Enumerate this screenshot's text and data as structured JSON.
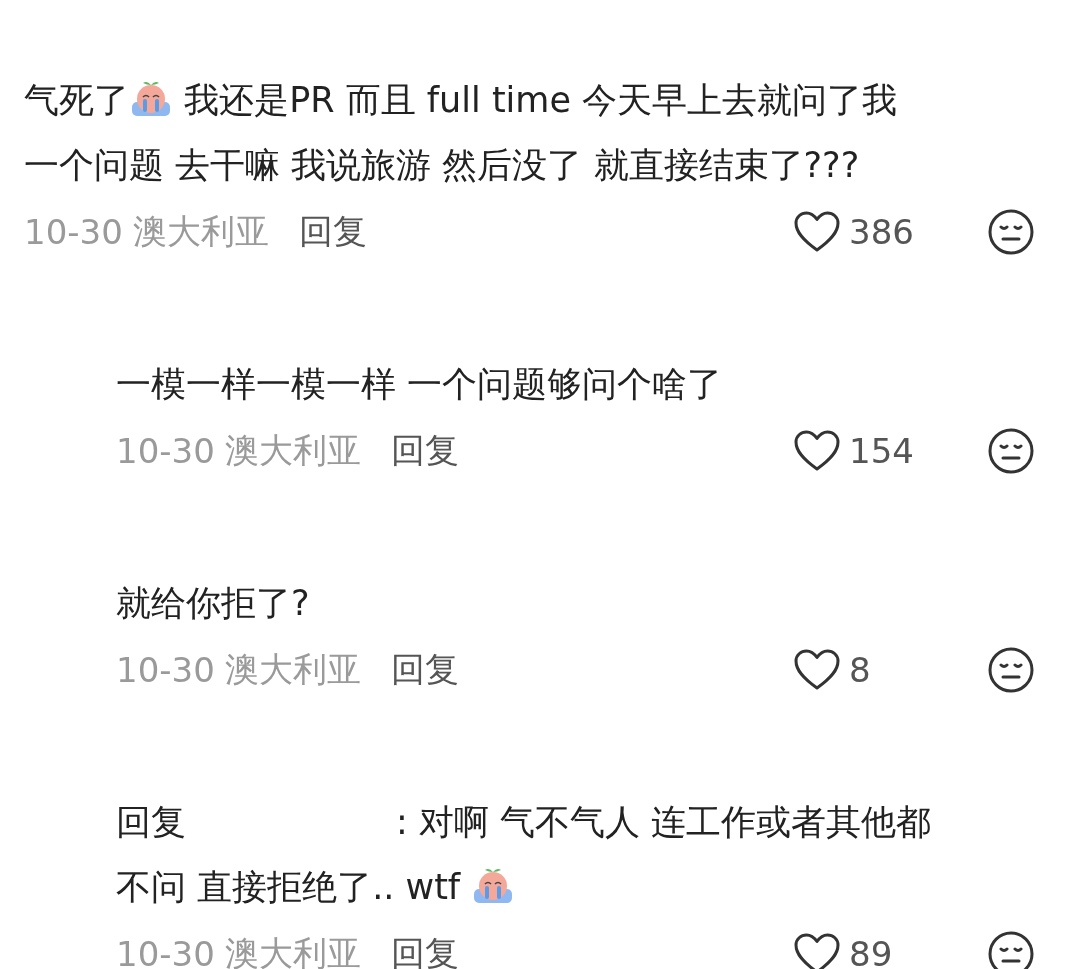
{
  "comments": [
    {
      "kind": "top",
      "segments": [
        {
          "kind": "text",
          "text": "气死了"
        },
        {
          "kind": "emoji"
        },
        {
          "kind": "text",
          "text": " 我还是PR 而且 full time 今天早上去就问了我"
        },
        {
          "kind": "break"
        },
        {
          "kind": "text",
          "text": "一个问题 去干嘛 我说旅游 然后没了 就直接结束了???"
        }
      ],
      "date": "10-30",
      "region": "澳大利亚",
      "reply_label": "回复",
      "likes": "386"
    },
    {
      "kind": "reply",
      "segments": [
        {
          "kind": "text",
          "text": "一模一样一模一样 一个问题够问个啥了"
        }
      ],
      "date": "10-30",
      "region": "澳大利亚",
      "reply_label": "回复",
      "likes": "154"
    },
    {
      "kind": "reply",
      "segments": [
        {
          "kind": "text",
          "text": "就给你拒了?"
        }
      ],
      "date": "10-30",
      "region": "澳大利亚",
      "reply_label": "回复",
      "likes": "8"
    },
    {
      "kind": "reply",
      "segments": [
        {
          "kind": "text",
          "text": "回复"
        },
        {
          "kind": "redacted"
        },
        {
          "kind": "text",
          "text": ": 对啊 气不气人 连工作或者其他都"
        },
        {
          "kind": "break"
        },
        {
          "kind": "text",
          "text": "不问 直接拒绝了.. wtf "
        },
        {
          "kind": "emoji"
        }
      ],
      "date": "10-30",
      "region": "澳大利亚",
      "reply_label": "回复",
      "likes": "89"
    }
  ]
}
